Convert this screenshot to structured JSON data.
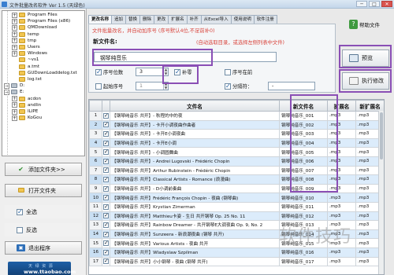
{
  "window": {
    "title": "文件批量改名软件 Ver 1.5 (天绿色)",
    "minimize_glyph": "─",
    "maximize_glyph": "□",
    "close_glyph": "✕"
  },
  "colors": {
    "annotation": "#8a4fb5",
    "hint_red": "#d9443c",
    "brand_blue": "#1d5fa6"
  },
  "folder_tree": {
    "items": [
      {
        "label": "Program Files",
        "depth": 2,
        "kind": "folder",
        "expander": "+"
      },
      {
        "label": "Program Files (x86)",
        "depth": 2,
        "kind": "folder",
        "expander": "+"
      },
      {
        "label": "QMDownload",
        "depth": 2,
        "kind": "folder",
        "expander": "+"
      },
      {
        "label": "temp",
        "depth": 2,
        "kind": "folder",
        "expander": "+"
      },
      {
        "label": "tmp",
        "depth": 2,
        "kind": "folder",
        "expander": "+"
      },
      {
        "label": "Users",
        "depth": 2,
        "kind": "folder",
        "expander": "+"
      },
      {
        "label": "Windows",
        "depth": 2,
        "kind": "folder",
        "expander": "+"
      },
      {
        "label": "~vs1",
        "depth": 2,
        "kind": "folder",
        "expander": ""
      },
      {
        "label": "a.tmt",
        "depth": 2,
        "kind": "folder",
        "expander": ""
      },
      {
        "label": "GUDownLoaddelog.txt",
        "depth": 2,
        "kind": "folder",
        "expander": ""
      },
      {
        "label": "log.txt",
        "depth": 2,
        "kind": "folder",
        "expander": ""
      },
      {
        "label": "D:",
        "depth": 1,
        "kind": "drive",
        "expander": "−"
      },
      {
        "label": "E:",
        "depth": 1,
        "kind": "drive",
        "expander": "−"
      },
      {
        "label": "acdon",
        "depth": 2,
        "kind": "folder",
        "expander": "+"
      },
      {
        "label": "andlin",
        "depth": 2,
        "kind": "folder",
        "expander": "+"
      },
      {
        "label": "ILIPE",
        "depth": 2,
        "kind": "folder",
        "expander": "+"
      },
      {
        "label": "KoGou",
        "depth": 2,
        "kind": "folder",
        "expander": "+"
      }
    ]
  },
  "sidebar": {
    "add_folder": {
      "label": "添加文件夹>>",
      "icon": "add-folder-icon"
    },
    "open_folder": {
      "label": "打开文件夹",
      "icon": "open-folder-icon"
    },
    "select_all": {
      "label": "全选",
      "checked": true
    },
    "invert": {
      "label": "反选",
      "checked": false
    },
    "exit": {
      "label": "退出程序",
      "icon": "exit-icon"
    }
  },
  "brand": {
    "line1": "天 绿 资 源",
    "line2": "www.ttaobao.com"
  },
  "tabs": [
    {
      "label": "更改名称",
      "active": true
    },
    {
      "label": "追加",
      "active": false
    },
    {
      "label": "替换",
      "active": false
    },
    {
      "label": "删除",
      "active": false
    },
    {
      "label": "更改",
      "active": false
    },
    {
      "label": "扩展名",
      "active": false
    },
    {
      "label": "补齐",
      "active": false
    },
    {
      "label": "从Excel导入",
      "active": false
    },
    {
      "label": "使用说明",
      "active": false
    },
    {
      "label": "软件注册",
      "active": false
    }
  ],
  "help_button": {
    "label": "帮助文件",
    "icon": "help-book-icon"
  },
  "rename_panel": {
    "hint": "文件批量改名，并自动加序号 (序号默认4位,不足前补0)",
    "new_name_label": "新文件名:",
    "select_hint": "(自动选取目录，或选择左侧列表中文件)",
    "name_value": "钢琴纯音乐",
    "seq_digits": {
      "label": "序号位数",
      "checked": true,
      "value": "3"
    },
    "suffix": {
      "label": "补零",
      "checked": true
    },
    "seq_front": {
      "label": "序号在前",
      "checked": false
    },
    "start_seq": {
      "label": "起始序号",
      "checked": false,
      "value": "1"
    },
    "separator": {
      "label": "分隔符：",
      "checked": true,
      "value": "-"
    },
    "spin_up": "▲",
    "spin_down": "▼"
  },
  "actions": {
    "preview": {
      "label": "预览",
      "icon": "preview-icon"
    },
    "execute": {
      "label": "执行修改",
      "icon": "execute-icon"
    }
  },
  "file_table": {
    "headers": [
      "",
      "",
      "文件名",
      "新文件名",
      "扩展名",
      "新扩展名"
    ],
    "rows": [
      {
        "num": "1",
        "name": "【钢琴纯音乐 共开】- 秋程的中的夜",
        "new_name": "钢琴纯音乐_001",
        "ext": ".mp3",
        "new_ext": ".mp3"
      },
      {
        "num": "2",
        "name": "【钢琴纯音乐 共开】- 卡开小调夜曲作曲者",
        "new_name": "钢琴纯音乐_002",
        "ext": ".mp3",
        "new_ext": ".mp3"
      },
      {
        "num": "3",
        "name": "【钢琴纯音乐 共开】- 卡开E小调夜曲",
        "new_name": "钢琴纯音乐_003",
        "ext": ".mp3",
        "new_ext": ".mp3"
      },
      {
        "num": "4",
        "name": "【钢琴纯音乐 共开】- 卡开E小调",
        "new_name": "钢琴纯音乐_004",
        "ext": ".mp3",
        "new_ext": ".mp3"
      },
      {
        "num": "5",
        "name": "【钢琴纯音乐 共开】- 小调圆舞曲",
        "new_name": "钢琴纯音乐_005",
        "ext": ".mp3",
        "new_ext": ".mp3"
      },
      {
        "num": "6",
        "name": "【钢琴纯音乐 共开】- Andrei Lugovski - Frédéric Chopin",
        "new_name": "钢琴纯音乐_006",
        "ext": ".mp3",
        "new_ext": ".mp3"
      },
      {
        "num": "7",
        "name": "【钢琴纯音乐 共开】Arthur Rubinstein - Frédéric Chopin",
        "new_name": "钢琴纯音乐_007",
        "ext": ".mp3",
        "new_ext": ".mp3"
      },
      {
        "num": "8",
        "name": "【钢琴纯音乐 共开】Classical Artists - Romance (浪漫曲)",
        "new_name": "钢琴纯音乐_008",
        "ext": ".mp3",
        "new_ext": ".mp3"
      },
      {
        "num": "9",
        "name": "【钢琴纯音乐 共开】- D小调前奏曲",
        "new_name": "钢琴纯音乐_009",
        "ext": ".mp3",
        "new_ext": ".mp3"
      },
      {
        "num": "10",
        "name": "【钢琴纯音乐 共开】Frédéric François Chopin - 夜曲 (钢琴曲)",
        "new_name": "钢琴纯音乐_010",
        "ext": ".mp3",
        "new_ext": ".mp3"
      },
      {
        "num": "11",
        "name": "【钢琴纯音乐 共开】Krystian Zimerman",
        "new_name": "钢琴纯音乐_011",
        "ext": ".mp3",
        "new_ext": ".mp3"
      },
      {
        "num": "12",
        "name": "【钢琴纯音乐 共开】Matthieu卡姿 - 生日 共开钢琴 Op. 25 No. 11",
        "new_name": "钢琴纯音乐_012",
        "ext": ".mp3",
        "new_ext": ".mp3"
      },
      {
        "num": "13",
        "name": "【钢琴纯音乐 共开】Rainbow Dreamer - 共开钢琴E大调夜曲 Op. 9, No. 2",
        "new_name": "钢琴纯音乐_013",
        "ext": ".mp3",
        "new_ext": ".mp3"
      },
      {
        "num": "14",
        "name": "【钢琴纯音乐 共开】Sunzeera - 新浪潮夜曲 (钢琴 共开)",
        "new_name": "钢琴纯音乐_014",
        "ext": ".mp3",
        "new_ext": ".mp3"
      },
      {
        "num": "15",
        "name": "【钢琴纯音乐 共开】Various Artists - 夜曲 共开",
        "new_name": "钢琴纯音乐_015",
        "ext": ".mp3",
        "new_ext": ".mp3"
      },
      {
        "num": "16",
        "name": "【钢琴纯音乐 共开】Wladyslaw Szpilman",
        "new_name": "钢琴纯音乐_016",
        "ext": ".mp3",
        "new_ext": ".mp3"
      },
      {
        "num": "17",
        "name": "【钢琴纯音乐 共开】小小钢琴 - 夜曲 (钢琴 共开)",
        "new_name": "钢琴纯音乐_017",
        "ext": ".mp3",
        "new_ext": ".mp3"
      }
    ]
  },
  "watermark": "软件技巧"
}
